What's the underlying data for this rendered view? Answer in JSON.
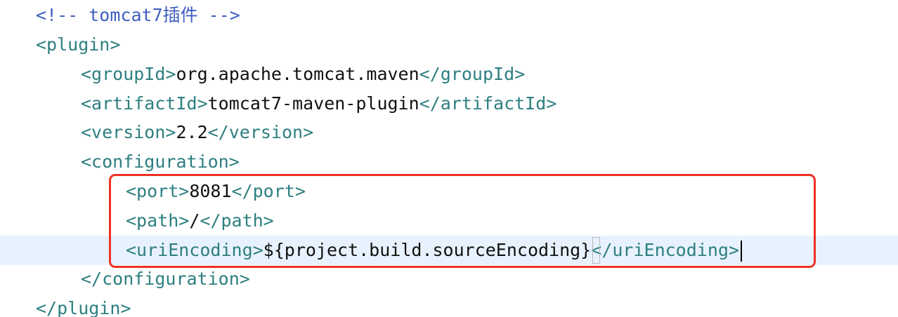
{
  "editor": {
    "lines": [
      {
        "id": "comment",
        "comment": "<!-- tomcat7插件 -->"
      },
      {
        "id": "plugin-open",
        "open": "<plugin>"
      },
      {
        "id": "groupid",
        "open": "<groupId>",
        "text": "org.apache.tomcat.maven",
        "close": "</groupId>"
      },
      {
        "id": "artifactid",
        "open": "<artifactId>",
        "text": "tomcat7-maven-plugin",
        "close": "</artifactId>"
      },
      {
        "id": "version",
        "open": "<version>",
        "text": "2.2",
        "close": "</version>"
      },
      {
        "id": "configuration-open",
        "open": "<configuration>"
      },
      {
        "id": "port",
        "open": "<port>",
        "text": "8081",
        "close": "</port>"
      },
      {
        "id": "path",
        "open": "<path>",
        "text": "/",
        "close": "</path>"
      },
      {
        "id": "uriencoding",
        "open": "<uriEncoding>",
        "text": "${project.build.sourceEncoding}",
        "close_lt": "<",
        "close_rest": "/uriEncoding>"
      },
      {
        "id": "configuration-close",
        "close": "</configuration>"
      },
      {
        "id": "plugin-close",
        "close": "</plugin>"
      }
    ],
    "highlight_color": "#ee3124",
    "tag_color": "#2e7f80",
    "comment_color": "#3f5fbf",
    "current_line_color": "#e8f2fe"
  }
}
